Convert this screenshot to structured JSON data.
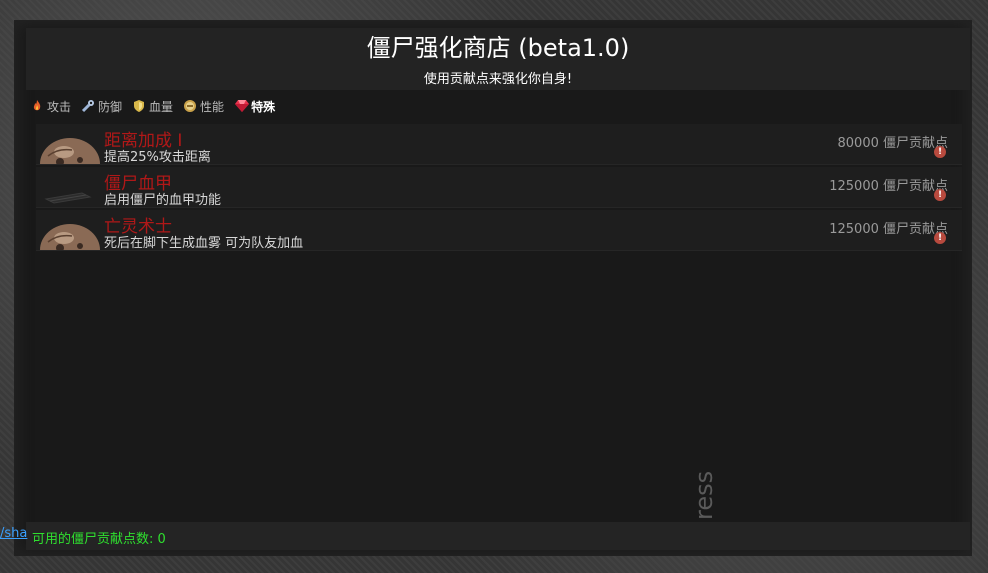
{
  "header": {
    "title": "僵尸强化商店 (beta1.0)",
    "subtitle": "使用贡献点来强化你自身!"
  },
  "tabs": [
    {
      "label": "攻击",
      "icon": "fire-icon"
    },
    {
      "label": "防御",
      "icon": "wrench-icon"
    },
    {
      "label": "血量",
      "icon": "shield-icon"
    },
    {
      "label": "性能",
      "icon": "gear-icon"
    },
    {
      "label": "特殊",
      "icon": "gem-icon"
    }
  ],
  "items": [
    {
      "name": "距离加成 I",
      "desc": "提高25%攻击距离",
      "price": "80000 僵尸贡献点",
      "thumb": "skull-thumb"
    },
    {
      "name": "僵尸血甲",
      "desc": "启用僵尸的血甲功能",
      "price": "125000 僵尸贡献点",
      "thumb": "weapon-thumb"
    },
    {
      "name": "亡灵术士",
      "desc": "死后在脚下生成血雾 可为队友加血",
      "price": "125000 僵尸贡献点",
      "thumb": "skull-thumb"
    }
  ],
  "footer": {
    "balance": "可用的僵尸贡献点数: 0",
    "edge_link": "/sha"
  },
  "watermark": "ress",
  "colors": {
    "item_name": "#b01818",
    "balance": "#2fe02f"
  }
}
